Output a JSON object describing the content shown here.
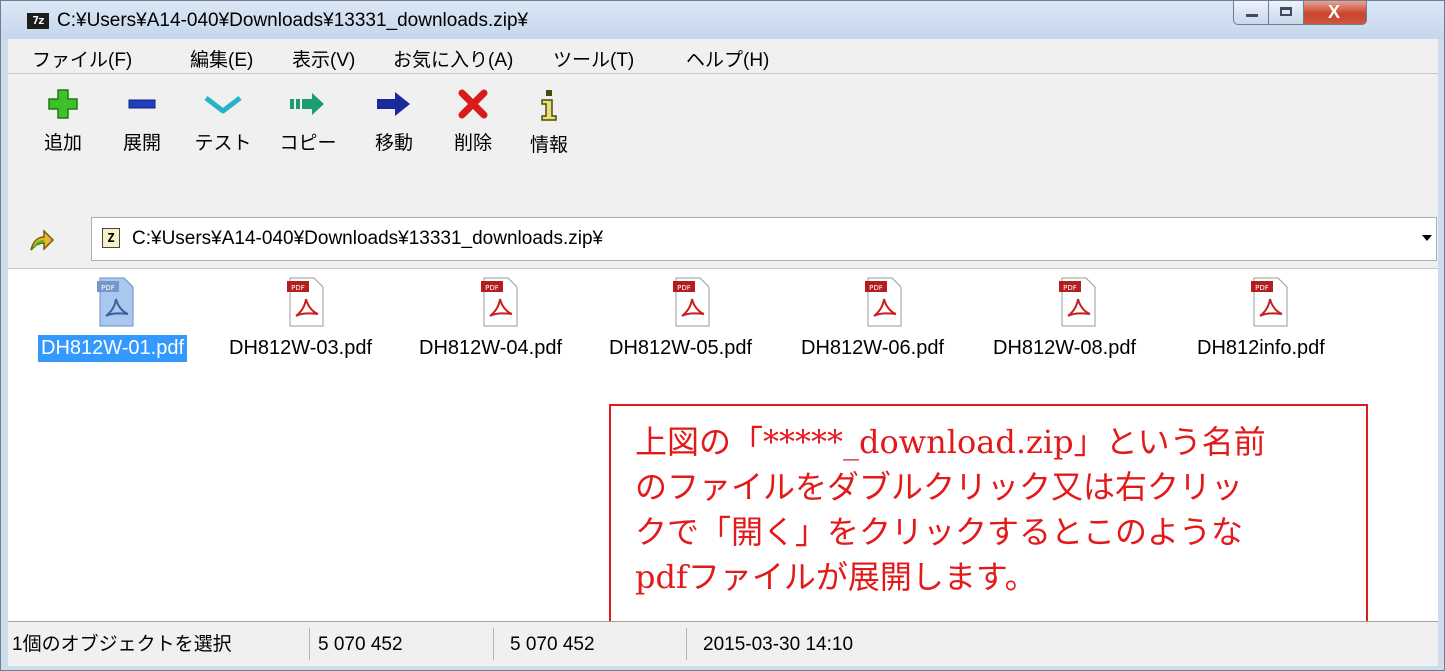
{
  "window": {
    "title": "C:¥Users¥A14-040¥Downloads¥13331_downloads.zip¥",
    "app_icon_text": "7z",
    "close_glyph": "X"
  },
  "menu": {
    "items": [
      "ファイル(F)",
      "編集(E)",
      "表示(V)",
      "お気に入り(A)",
      "ツール(T)",
      "ヘルプ(H)"
    ]
  },
  "toolbar": {
    "buttons": [
      {
        "label": "追加",
        "icon": "add-icon",
        "color": "#3fbf2a"
      },
      {
        "label": "展開",
        "icon": "extract-icon",
        "color": "#1f3fbf"
      },
      {
        "label": "テスト",
        "icon": "test-icon",
        "color": "#27b3c7"
      },
      {
        "label": "コピー",
        "icon": "copy-icon",
        "color": "#1d9c6f"
      },
      {
        "label": "移動",
        "icon": "move-icon",
        "color": "#1a2a9c"
      },
      {
        "label": "削除",
        "icon": "delete-icon",
        "color": "#d81c1c"
      },
      {
        "label": "情報",
        "icon": "info-icon",
        "color": "#4a4a10"
      }
    ]
  },
  "address": {
    "icon_text": "Z",
    "path": "C:¥Users¥A14-040¥Downloads¥13331_downloads.zip¥"
  },
  "files": [
    {
      "name": "DH812W-01.pdf",
      "selected": true
    },
    {
      "name": "DH812W-03.pdf",
      "selected": false
    },
    {
      "name": "DH812W-04.pdf",
      "selected": false
    },
    {
      "name": "DH812W-05.pdf",
      "selected": false
    },
    {
      "name": "DH812W-06.pdf",
      "selected": false
    },
    {
      "name": "DH812W-08.pdf",
      "selected": false
    },
    {
      "name": "DH812info.pdf",
      "selected": false
    }
  ],
  "file_icon_label": "PDF",
  "annotation": {
    "text": "上図の「*****_download.zip」という名前\nのファイルをダブルクリック又は右クリッ\nクで「開く」をクリックするとこのような\npdfファイルが展開します。"
  },
  "status": {
    "selection": "1個のオブジェクトを選択",
    "size": "5 070 452",
    "packed_size": "5 070 452",
    "modified": "2015-03-30 14:10"
  },
  "colors": {
    "selection": "#3399ff",
    "annotation": "#e21a1a"
  }
}
